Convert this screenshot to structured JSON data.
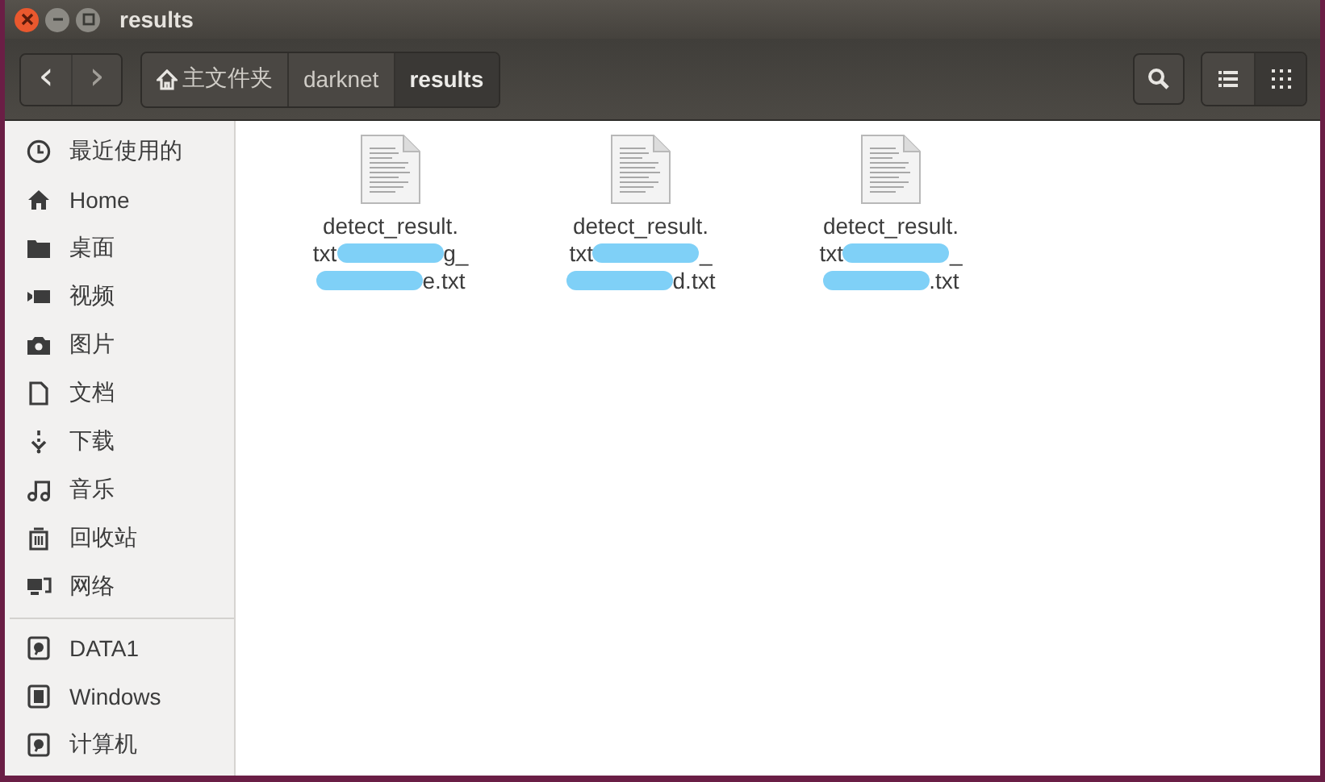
{
  "window": {
    "title": "results"
  },
  "toolbar": {
    "back": "‹",
    "forward": "›",
    "breadcrumbs": [
      {
        "label": "主文件夹",
        "kind": "home",
        "selected": false
      },
      {
        "label": "darknet",
        "kind": "folder",
        "selected": false
      },
      {
        "label": "results",
        "kind": "folder",
        "selected": true
      }
    ],
    "views": [
      {
        "kind": "list",
        "selected": false
      },
      {
        "kind": "grid",
        "selected": true
      }
    ]
  },
  "sidebar": {
    "places": [
      {
        "label": "最近使用的",
        "kind": "recent"
      },
      {
        "label": "Home",
        "kind": "home"
      },
      {
        "label": "桌面",
        "kind": "desktop"
      },
      {
        "label": "视频",
        "kind": "video"
      },
      {
        "label": "图片",
        "kind": "pictures"
      },
      {
        "label": "文档",
        "kind": "documents"
      },
      {
        "label": "下载",
        "kind": "downloads"
      },
      {
        "label": "音乐",
        "kind": "music"
      },
      {
        "label": "回收站",
        "kind": "trash"
      },
      {
        "label": "网络",
        "kind": "network"
      }
    ],
    "devices": [
      {
        "label": "DATA1",
        "kind": "drive"
      },
      {
        "label": "Windows",
        "kind": "chip"
      },
      {
        "label": "计算机",
        "kind": "drive"
      }
    ]
  },
  "files": [
    {
      "lines": [
        [
          {
            "kind": "text",
            "text": "detect_result."
          }
        ],
        [
          {
            "kind": "text",
            "text": "txt"
          },
          {
            "kind": "redacted"
          },
          {
            "kind": "text",
            "text": "g_"
          }
        ],
        [
          {
            "kind": "redacted"
          },
          {
            "kind": "text",
            "text": "e.txt"
          }
        ]
      ]
    },
    {
      "lines": [
        [
          {
            "kind": "text",
            "text": "detect_result."
          }
        ],
        [
          {
            "kind": "text",
            "text": "txt"
          },
          {
            "kind": "redacted"
          },
          {
            "kind": "text",
            "text": "_"
          }
        ],
        [
          {
            "kind": "redacted"
          },
          {
            "kind": "text",
            "text": "d.txt"
          }
        ]
      ]
    },
    {
      "lines": [
        [
          {
            "kind": "text",
            "text": "detect_result."
          }
        ],
        [
          {
            "kind": "text",
            "text": "txt"
          },
          {
            "kind": "redacted"
          },
          {
            "kind": "text",
            "text": "_"
          }
        ],
        [
          {
            "kind": "redacted"
          },
          {
            "kind": "text",
            "text": ".txt"
          }
        ]
      ]
    }
  ]
}
